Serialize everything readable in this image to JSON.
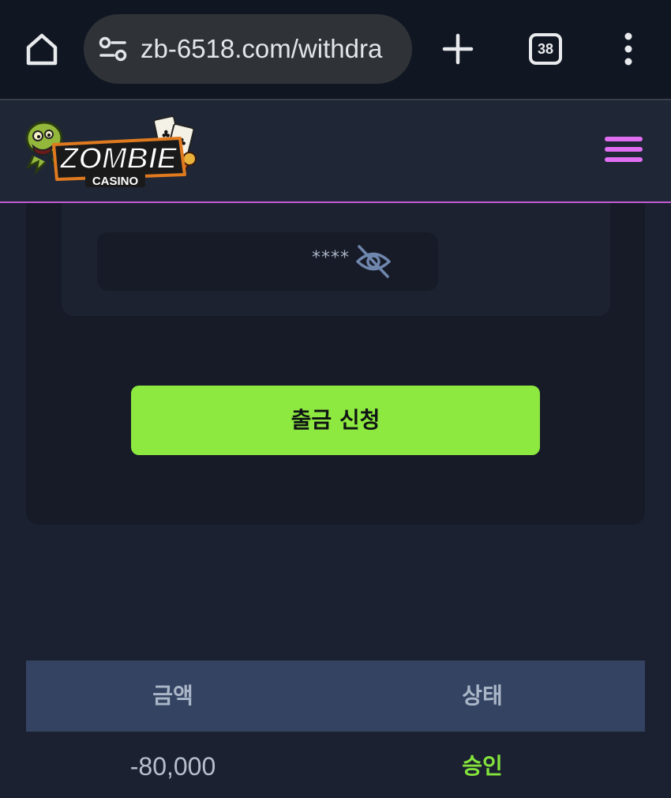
{
  "browser": {
    "url": "zb-6518.com/withdra",
    "tab_count": "38"
  },
  "header": {
    "logo_title": "ZOMBIE",
    "logo_subtitle": "CASINO"
  },
  "form": {
    "password_mask": "****",
    "submit_label": "출금 신청"
  },
  "history_table": {
    "columns": [
      "금액",
      "상태"
    ],
    "rows": [
      {
        "amount": "-80,000",
        "status": "승인"
      }
    ]
  },
  "colors": {
    "accent_green": "#8de83f",
    "menu_pink": "#e06ef2",
    "header_divider": "#c45bd6"
  },
  "icons": [
    "home-icon",
    "tune-icon",
    "plus-icon",
    "tabs-icon",
    "more-vert-icon",
    "hamburger-icon",
    "eye-off-icon"
  ]
}
